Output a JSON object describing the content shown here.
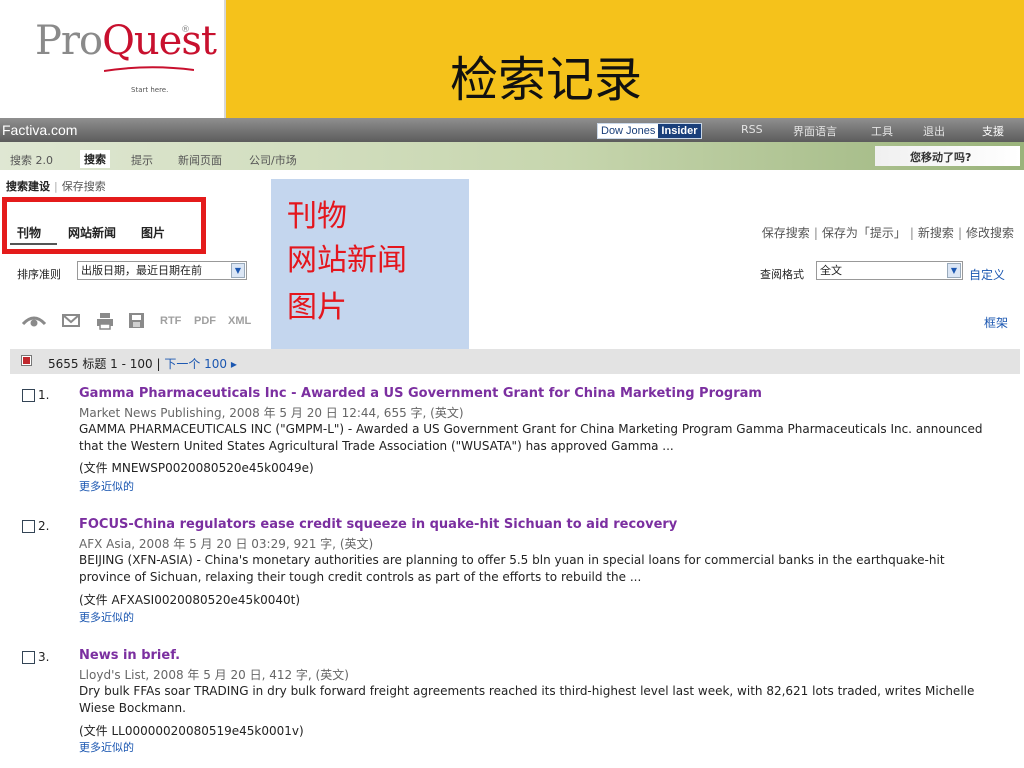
{
  "slide": {
    "logo_text_pro": "Pro",
    "logo_text_quest": "Quest",
    "logo_registered": "®",
    "logo_tagline": "Start here.",
    "title": "检索记录"
  },
  "topbar": {
    "brand": "Factiva.com",
    "badge_left": "Dow Jones",
    "badge_right": "Insider",
    "links": [
      "RSS",
      "界面语言",
      "工具",
      "退出",
      "支援"
    ]
  },
  "nav": {
    "items": [
      "搜索 2.0",
      "搜索",
      "提示",
      "新闻页面",
      "公司/市场"
    ],
    "promo": "您移动了吗?"
  },
  "subnav": {
    "build": "搜索建设",
    "saved": "保存搜索"
  },
  "tabs": [
    "刊物",
    "网站新闻",
    "图片"
  ],
  "callout": [
    "刊物",
    "网站新闻",
    "图片"
  ],
  "search_actions": [
    "保存搜索",
    "保存为「提示」",
    "新搜索",
    "修改搜索"
  ],
  "sort": {
    "label": "排序准则",
    "value": "出版日期，最近日期在前"
  },
  "format": {
    "label": "查阅格式",
    "value": "全文",
    "customize": "自定义"
  },
  "toolbar": {
    "icons": [
      "eye-icon",
      "email-icon",
      "print-icon",
      "save-icon"
    ],
    "formats": [
      "RTF",
      "PDF",
      "XML"
    ],
    "frames": "框架"
  },
  "results_header": {
    "count_text": "5655 标题  1 - 100 | ",
    "next": "下一个 100 ▸"
  },
  "results": [
    {
      "num": "1.",
      "title": "Gamma Pharmaceuticals Inc - Awarded a US Government Grant for China Marketing Program",
      "source": "Market News Publishing, 2008 年 5 月 20 日 12:44, 655 字, (英文)",
      "snippet": "GAMMA PHARMACEUTICALS INC (\"GMPM-L\") - Awarded a US Government Grant for China Marketing Program Gamma Pharmaceuticals Inc. announced that the Western United States Agricultural Trade Association (\"WUSATA\") has approved Gamma ...",
      "doc_id": "(文件 MNEWSP0020080520e45k0049e)",
      "more": "更多近似的"
    },
    {
      "num": "2.",
      "title": "FOCUS-China regulators ease credit squeeze in quake-hit Sichuan to aid recovery",
      "source": "AFX Asia, 2008 年 5 月 20 日 03:29, 921 字, (英文)",
      "snippet": "BEIJING (XFN-ASIA) - China's monetary authorities are planning to offer 5.5 bln yuan in special loans for commercial banks in the earthquake-hit province of Sichuan, relaxing their tough credit controls as part of the efforts to rebuild the ...",
      "doc_id": "(文件 AFXASI0020080520e45k0040t)",
      "more": "更多近似的"
    },
    {
      "num": "3.",
      "title": "News in brief.",
      "source": "Lloyd's List, 2008 年 5 月 20 日, 412 字, (英文)",
      "snippet": "Dry bulk FFAs soar TRADING in dry bulk forward freight agreements reached its third-highest level last week, with 82,621 lots traded, writes Michelle Wiese Bockmann.",
      "doc_id": "(文件 LL00000020080519e45k0001v)",
      "more": "更多近似的"
    }
  ]
}
